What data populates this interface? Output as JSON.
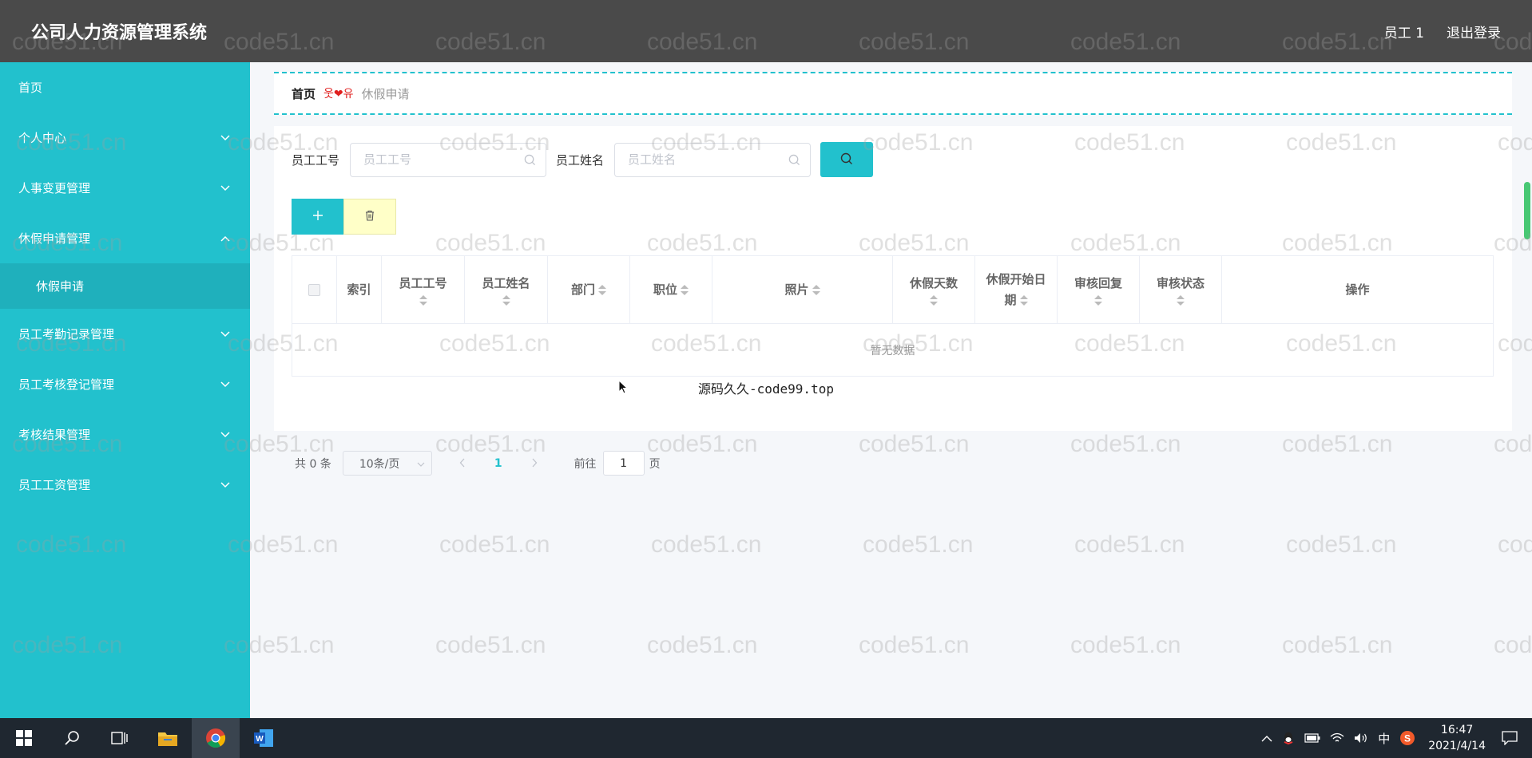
{
  "header": {
    "app_title": "公司人力资源管理系统",
    "user_label": "员工 1",
    "logout_label": "退出登录"
  },
  "sidebar": {
    "items": [
      {
        "label": "首页"
      },
      {
        "label": "个人中心"
      },
      {
        "label": "人事变更管理"
      },
      {
        "label": "休假申请管理"
      },
      {
        "label": "休假申请"
      },
      {
        "label": "员工考勤记录管理"
      },
      {
        "label": "员工考核登记管理"
      },
      {
        "label": "考核结果管理"
      },
      {
        "label": "员工工资管理"
      }
    ]
  },
  "breadcrumb": {
    "home": "首页",
    "separator": "웃❤유",
    "current": "休假申请"
  },
  "search": {
    "emp_no_label": "员工工号",
    "emp_no_placeholder": "员工工号",
    "emp_name_label": "员工姓名",
    "emp_name_placeholder": "员工姓名"
  },
  "actions": {
    "add_icon": "plus-icon",
    "delete_icon": "trash-icon"
  },
  "table": {
    "columns": [
      "索引",
      "员工工号",
      "员工姓名",
      "部门",
      "职位",
      "照片",
      "休假天数",
      "休假开始日期",
      "审核回复",
      "审核状态",
      "操作"
    ],
    "col_dept_start": "休假开始日",
    "col_dept_end": "期",
    "empty_text": "暂无数据"
  },
  "pagination": {
    "total": "共 0 条",
    "page_size": "10条/页",
    "current_page": "1",
    "goto_label": "前往",
    "goto_value": "1",
    "unit": "页"
  },
  "promo_text": "源码久久-code99.top",
  "watermark_text": "code51.cn",
  "taskbar": {
    "time": "16:47",
    "date": "2021/4/14",
    "ime": "中"
  },
  "colors": {
    "accent": "#22c1cd",
    "header_bg": "#4a4a4a",
    "taskbar_bg": "#1f2730"
  }
}
